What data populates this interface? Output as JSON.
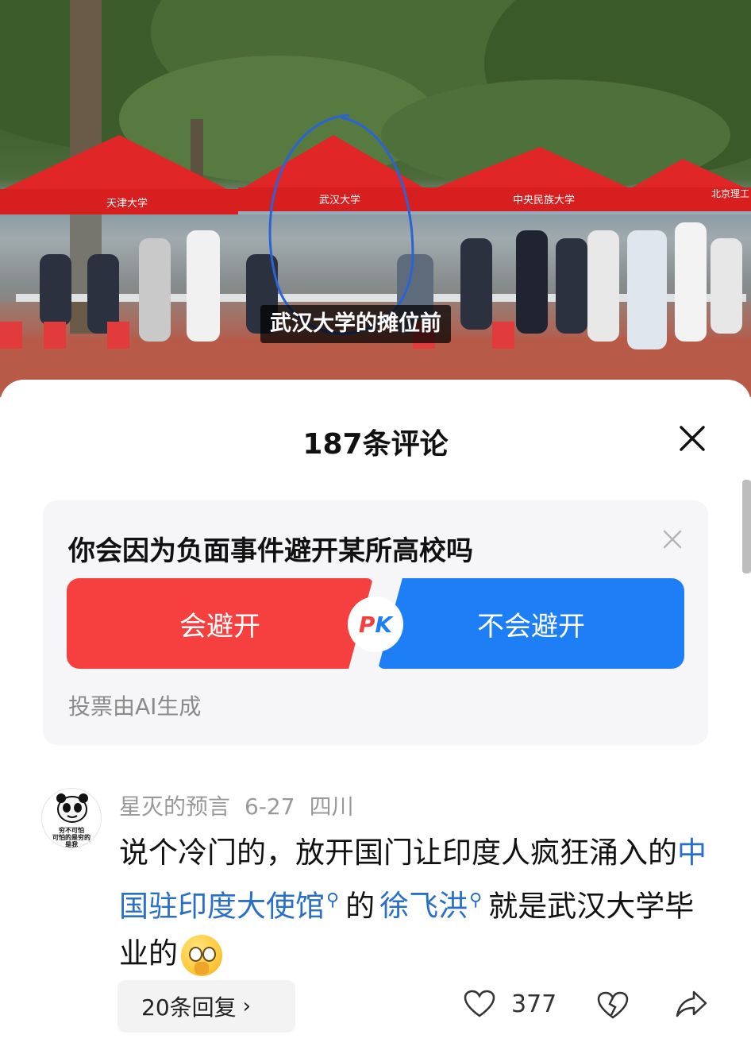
{
  "video": {
    "caption": "武汉大学的摊位前",
    "booth_signs": [
      "天津大学",
      "武汉大学",
      "中央民族大学",
      "北京理工"
    ]
  },
  "comments_sheet": {
    "title": "187条评论",
    "close_icon": "close-icon"
  },
  "poll": {
    "question": "你会因为负面事件避开某所高校吗",
    "option_a": "会避开",
    "option_b": "不会避开",
    "pk_p": "P",
    "pk_k": "K",
    "note": "投票由AI生成",
    "colors": {
      "option_a": "#f5403f",
      "option_b": "#1d7ef5"
    }
  },
  "comment": {
    "avatar_text": "穷不可怕\n可怕的是穷的\n是我",
    "username": "星灭的预言",
    "date": "6-27",
    "location": "四川",
    "text_1": "说个冷门的，放开国门让印度人疯狂涌入的",
    "link_1": "中国驻印度大使馆",
    "text_2": "的",
    "link_2": "徐飞洪",
    "text_3": "就是武汉大学毕业的",
    "replies_label": "20条回复",
    "like_count": "377"
  }
}
